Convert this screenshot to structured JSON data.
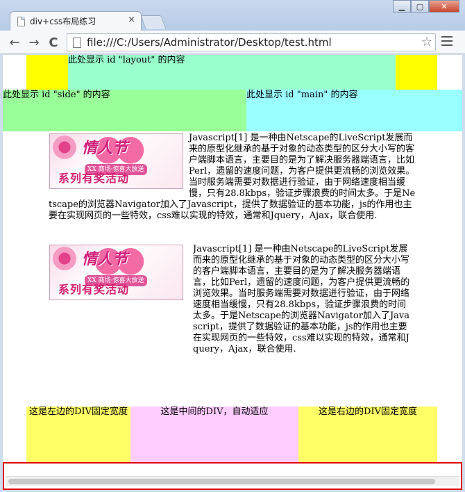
{
  "window": {
    "tab_title": "div+css布局练习",
    "tab_close": "×",
    "controls": {
      "minimize": "▁",
      "maximize": "▢",
      "close": "✕"
    }
  },
  "toolbar": {
    "back": "←",
    "forward": "→",
    "reload": "C",
    "url": "file:///C:/Users/Administrator/Desktop/test.html",
    "star": "☆"
  },
  "page": {
    "layout_text": "此处显示 id \"layout\" 的内容",
    "side_text": "此处显示 id \"side\" 的内容",
    "main_text": "此处显示 id \"main\" 的内容",
    "ad_image": {
      "title": "情人节",
      "subtitle": "XX 商场·惊喜大放送",
      "bottom": "系列有奖活动"
    },
    "article1": "Javascript[1] 是一种由Netscape的LiveScript发展而来的原型化继承的基于对象的动态类型的区分大小写的客户端脚本语言，主要目的是为了解决服务器端语言，比如Perl，遗留的速度问题，为客户提供更流畅的浏览效果。当时服务端需要对数据进行验证，由于网络速度相当缓慢，只有28.8kbps，验证步骤浪费的时间太多。于是Netscape的浏览器Navigator加入了Javascript，提供了数据验证的基本功能，js的作用也主要在实现网页的一些特效，css难以实现的特效，通常和Jquery，Ajax，联合使用.",
    "article2": "Javascript[1] 是一种由Netscape的LiveScript发展而来的原型化继承的基于对象的动态类型的区分大小写的客户端脚本语言，主要目的是为了解决服务器端语言，比如Perl，遗留的速度问题，为客户提供更流畅的浏览效果。当时服务端需要对数据进行验证，由于网络速度相当缓慢，只有28.8kbps，验证步骤浪费的时间太多。于是Netscape的浏览器Navigator加入了Javascript，提供了数据验证的基本功能，js的作用也主要在实现网页的一些特效，css难以实现的特效，通常和Jquery，Ajax，联合使用.",
    "left_fixed": "这是左边的DIV固定宽度",
    "center_auto": "这是中间的DIV，自动适应",
    "right_fixed": "这是右边的DIV固定宽度"
  },
  "colors": {
    "layout_outer": "#ffff00",
    "layout_inner": "#99ffcc",
    "side": "#99ff99",
    "main": "#99ffff",
    "fixed_sides": "#ffff66",
    "center": "#ffccff",
    "highlight_border": "#e00000"
  }
}
